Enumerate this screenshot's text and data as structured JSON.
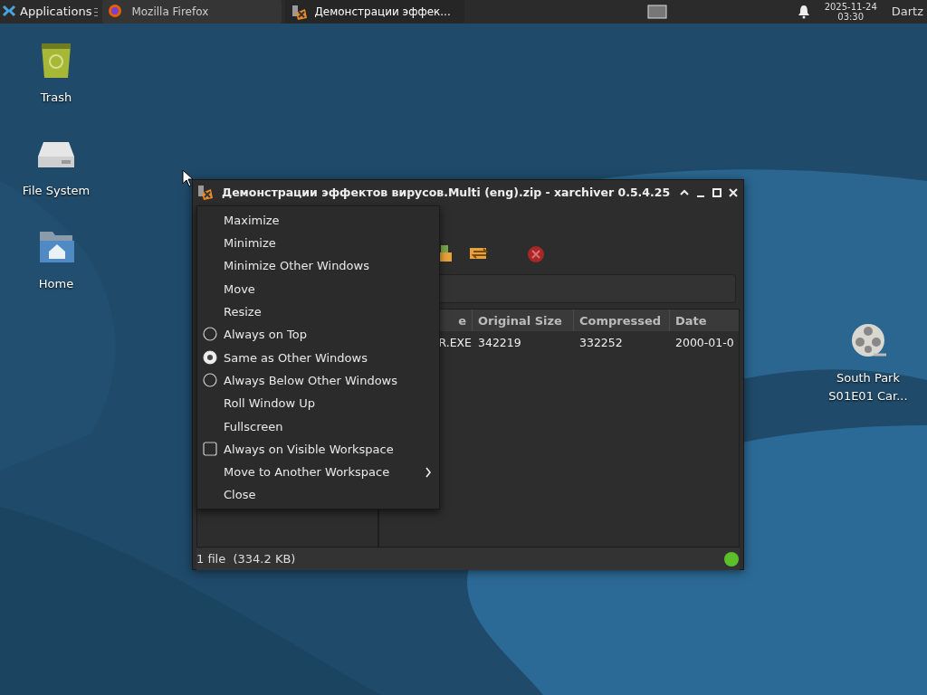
{
  "panel": {
    "applications_label": "Applications",
    "tasks": [
      {
        "label": "Mozilla Firefox",
        "kind": "firefox",
        "selected": false
      },
      {
        "label": "Демонстрации эффек...",
        "kind": "archiver",
        "selected": true
      }
    ],
    "clock": {
      "date": "2025-11-24",
      "time": "03:30"
    },
    "user": "Dartz"
  },
  "desktop_icons": [
    {
      "label": "Trash",
      "kind": "trash"
    },
    {
      "label": "File System",
      "kind": "drive"
    },
    {
      "label": "Home",
      "kind": "home"
    },
    {
      "label": "South Park S01E01 Car...",
      "kind": "video"
    }
  ],
  "window": {
    "title": "Демонстрации эффектов вирусов.Multi (eng).zip - xarchiver 0.5.4.25",
    "columns": [
      "e",
      "Original Size",
      "Compressed",
      "Date"
    ],
    "rows": [
      [
        "R.EXE",
        "342219",
        "332252",
        "2000-01-0"
      ]
    ],
    "status": "1 file  (334.2 KB)"
  },
  "context_menu": {
    "items": [
      {
        "label": "Maximize",
        "kind": "plain"
      },
      {
        "label": "Minimize",
        "kind": "plain"
      },
      {
        "label": "Minimize Other Windows",
        "kind": "plain"
      },
      {
        "label": "Move",
        "kind": "plain"
      },
      {
        "label": "Resize",
        "kind": "plain"
      },
      {
        "label": "Always on Top",
        "kind": "radio",
        "selected": false
      },
      {
        "label": "Same as Other Windows",
        "kind": "radio",
        "selected": true
      },
      {
        "label": "Always Below Other Windows",
        "kind": "radio",
        "selected": false
      },
      {
        "label": "Roll Window Up",
        "kind": "plain"
      },
      {
        "label": "Fullscreen",
        "kind": "plain"
      },
      {
        "label": "Always on Visible Workspace",
        "kind": "check",
        "checked": false
      },
      {
        "label": "Move to Another Workspace",
        "kind": "submenu"
      },
      {
        "label": "Close",
        "kind": "plain"
      }
    ]
  }
}
